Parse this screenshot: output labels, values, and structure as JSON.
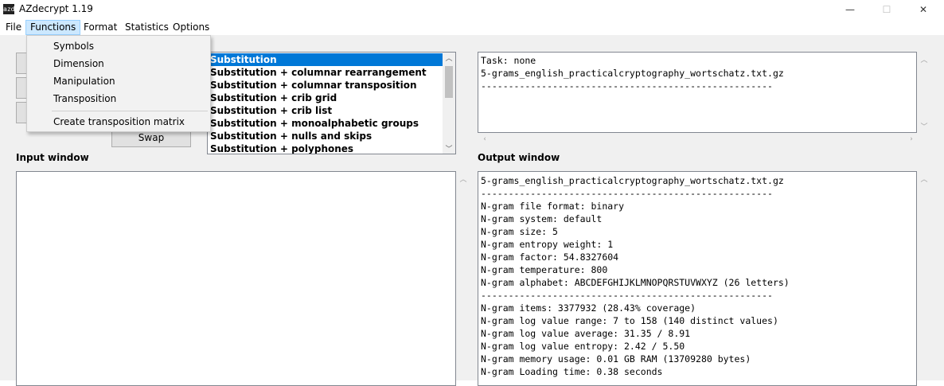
{
  "window": {
    "icon_text": "azd",
    "title": "AZdecrypt 1.19",
    "minimize_symbol": "—",
    "maximize_symbol": "☐",
    "close_symbol": "✕"
  },
  "menubar": {
    "items": [
      "File",
      "Functions",
      "Format",
      "Statistics",
      "Options"
    ],
    "active": "Functions"
  },
  "functions_menu": {
    "items": [
      "Symbols",
      "Dimension",
      "Manipulation",
      "Transposition"
    ],
    "extra_item": "Create transposition matrix"
  },
  "buttons": {
    "swap_label": "Swap"
  },
  "solver_list": {
    "items": [
      "Substitution",
      "Substitution + columnar rearrangement",
      "Substitution + columnar transposition",
      "Substitution + crib grid",
      "Substitution + crib list",
      "Substitution + monoalphabetic groups",
      "Substitution + nulls and skips",
      "Substitution + polyphones"
    ],
    "selected": "Substitution"
  },
  "task_box": {
    "lines": [
      "Task: none",
      "5-grams_english_practicalcryptography_wortschatz.txt.gz",
      "-----------------------------------------------------"
    ]
  },
  "input_window": {
    "label": "Input window",
    "text": ""
  },
  "output_window": {
    "label": "Output window",
    "lines": [
      "5-grams_english_practicalcryptography_wortschatz.txt.gz",
      "-----------------------------------------------------",
      "N-gram file format: binary",
      "N-gram system: default",
      "N-gram size: 5",
      "N-gram entropy weight: 1",
      "N-gram factor: 54.8327604",
      "N-gram temperature: 800",
      "N-gram alphabet: ABCDEFGHIJKLMNOPQRSTUVWXYZ (26 letters)",
      "-----------------------------------------------------",
      "N-gram items: 3377932 (28.43% coverage)",
      "N-gram log value range: 7 to 158 (140 distinct values)",
      "N-gram log value average: 31.35 / 8.91",
      "N-gram log value entropy: 2.42 / 5.50",
      "N-gram memory usage: 0.01 GB RAM (13709280 bytes)",
      "N-gram Loading time: 0.38 seconds"
    ]
  },
  "colors": {
    "selection": "#0078d7",
    "menu_highlight": "#cce8ff",
    "panel_bg": "#f0f0f0"
  }
}
